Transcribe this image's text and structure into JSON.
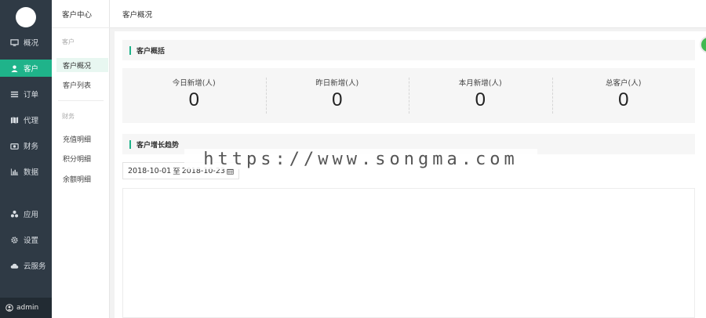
{
  "sidebar": {
    "items": [
      {
        "label": "概况",
        "icon": "monitor-icon"
      },
      {
        "label": "客户",
        "icon": "user-icon",
        "active": true
      },
      {
        "label": "订单",
        "icon": "list-icon"
      },
      {
        "label": "代理",
        "icon": "map-icon"
      },
      {
        "label": "财务",
        "icon": "camera-icon"
      },
      {
        "label": "数据",
        "icon": "bar-chart-icon"
      },
      {
        "label": "应用",
        "icon": "apps-icon"
      },
      {
        "label": "设置",
        "icon": "gear-icon"
      },
      {
        "label": "云服务",
        "icon": "cloud-icon"
      }
    ],
    "user": "admin"
  },
  "subnav": {
    "title": "客户中心",
    "group_customer": "客户",
    "group_finance": "财务",
    "items": [
      "客户概况",
      "客户列表",
      "充值明细",
      "积分明细",
      "余额明细"
    ]
  },
  "header": {
    "title": "客户概况"
  },
  "overview": {
    "section_title": "客户概括",
    "stats": [
      {
        "label": "今日新增(人)",
        "value": "0"
      },
      {
        "label": "昨日新增(人)",
        "value": "0"
      },
      {
        "label": "本月新增(人)",
        "value": "0"
      },
      {
        "label": "总客户(人)",
        "value": "0"
      }
    ]
  },
  "trend": {
    "section_title": "客户增长趋势",
    "date_start": "2018-10-01",
    "date_sep": "至",
    "date_end": "2018-10-23"
  },
  "watermark": "https://www.songma.com",
  "colors": {
    "accent": "#1fb38a",
    "sidebar_bg": "#2f3a45"
  }
}
